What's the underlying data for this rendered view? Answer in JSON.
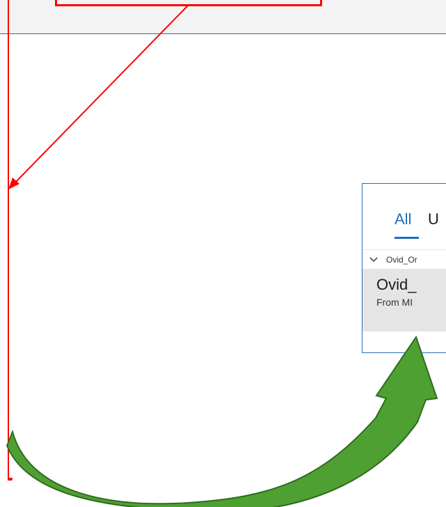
{
  "search_results": {
    "tabs": [
      {
        "label": "All",
        "selected": true
      },
      {
        "label": "U",
        "selected": false
      }
    ],
    "group": {
      "label": "Ovid_Or",
      "icon": "chevron-down-icon"
    },
    "result": {
      "title": "Ovid_",
      "subtitle": "From MI"
    }
  },
  "annotations": {
    "callout_color": "#ff0000",
    "arrow_color": "#4fa032"
  },
  "colors": {
    "accent": "#1a6fc0",
    "panel_border": "#2b6cb0"
  }
}
